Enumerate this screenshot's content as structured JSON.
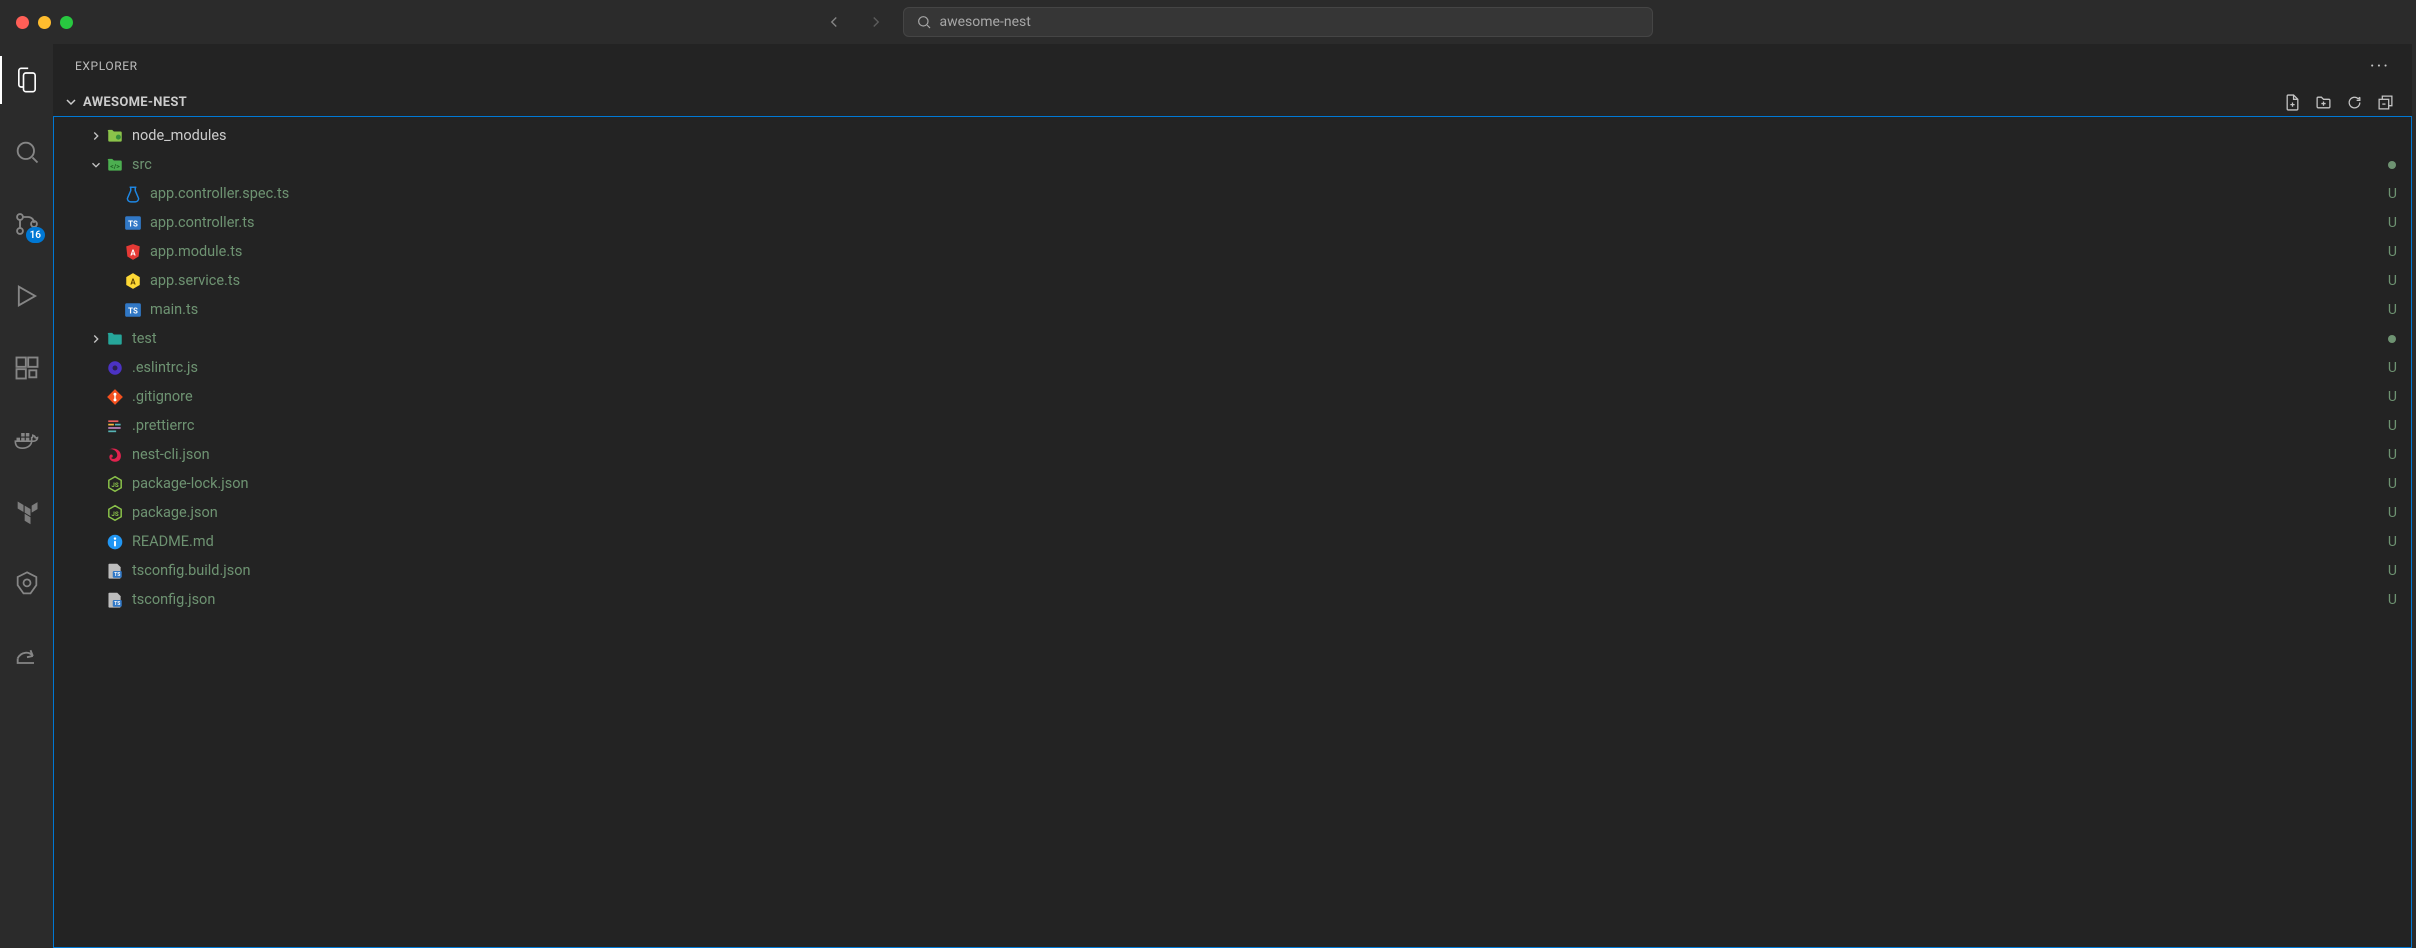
{
  "titlebar": {
    "project_name": "awesome-nest"
  },
  "activitybar": {
    "scm_badge": "16"
  },
  "explorer": {
    "title": "EXPLORER",
    "project": "AWESOME-NEST",
    "tree": [
      {
        "name": "node_modules",
        "type": "folder",
        "indent": 1,
        "expanded": false,
        "icon": "folder-node",
        "icon_color": "#8bc34a",
        "status": ""
      },
      {
        "name": "src",
        "type": "folder",
        "indent": 1,
        "expanded": true,
        "icon": "folder-src",
        "icon_color": "#4caf50",
        "status": "dot",
        "git": true
      },
      {
        "name": "app.controller.spec.ts",
        "type": "file",
        "indent": 2,
        "icon": "ts-test",
        "icon_color": "#1e88e5",
        "status": "U",
        "git": true
      },
      {
        "name": "app.controller.ts",
        "type": "file",
        "indent": 2,
        "icon": "ts",
        "icon_color": "#3178c6",
        "status": "U",
        "git": true
      },
      {
        "name": "app.module.ts",
        "type": "file",
        "indent": 2,
        "icon": "angular",
        "icon_color": "#e53935",
        "status": "U",
        "git": true
      },
      {
        "name": "app.service.ts",
        "type": "file",
        "indent": 2,
        "icon": "hex",
        "icon_color": "#fdd835",
        "status": "U",
        "git": true
      },
      {
        "name": "main.ts",
        "type": "file",
        "indent": 2,
        "icon": "ts",
        "icon_color": "#3178c6",
        "status": "U",
        "git": true
      },
      {
        "name": "test",
        "type": "folder",
        "indent": 1,
        "expanded": false,
        "icon": "folder-test",
        "icon_color": "#26a69a",
        "status": "dot",
        "git": true
      },
      {
        "name": ".eslintrc.js",
        "type": "file",
        "indent": 1,
        "icon": "eslint",
        "icon_color": "#4b32c3",
        "status": "U",
        "git": true
      },
      {
        "name": ".gitignore",
        "type": "file",
        "indent": 1,
        "icon": "git",
        "icon_color": "#f4511e",
        "status": "U",
        "git": true
      },
      {
        "name": ".prettierrc",
        "type": "file",
        "indent": 1,
        "icon": "prettier",
        "icon_color": "#ea5e5e",
        "status": "U",
        "git": true
      },
      {
        "name": "nest-cli.json",
        "type": "file",
        "indent": 1,
        "icon": "nest",
        "icon_color": "#e0234e",
        "status": "U",
        "git": true
      },
      {
        "name": "package-lock.json",
        "type": "file",
        "indent": 1,
        "icon": "node",
        "icon_color": "#8bc34a",
        "status": "U",
        "git": true
      },
      {
        "name": "package.json",
        "type": "file",
        "indent": 1,
        "icon": "node",
        "icon_color": "#8bc34a",
        "status": "U",
        "git": true
      },
      {
        "name": "README.md",
        "type": "file",
        "indent": 1,
        "icon": "info",
        "icon_color": "#2196f3",
        "status": "U",
        "git": true
      },
      {
        "name": "tsconfig.build.json",
        "type": "file",
        "indent": 1,
        "icon": "tsconfig",
        "icon_color": "#3178c6",
        "status": "U",
        "git": true
      },
      {
        "name": "tsconfig.json",
        "type": "file",
        "indent": 1,
        "icon": "tsconfig",
        "icon_color": "#3178c6",
        "status": "U",
        "git": true
      }
    ]
  }
}
